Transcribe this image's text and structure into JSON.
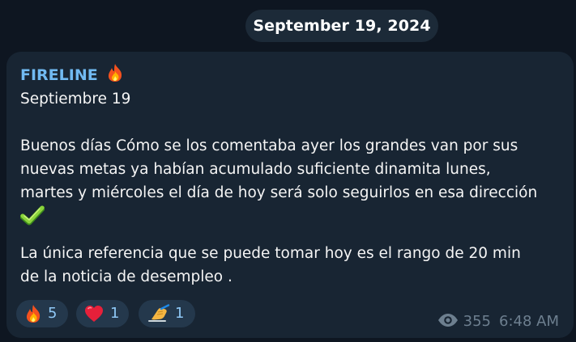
{
  "date_separator": "September 19, 2024",
  "message": {
    "sender": "FIRELINE",
    "sender_emoji": "fire-icon",
    "text": {
      "line1": "Septiembre 19",
      "line2": "Buenos días Cómo se los comentaba ayer los grandes van por sus",
      "line3": "nuevas metas ya habían acumulado suficiente dinamita lunes,",
      "line4": "martes y miércoles el día de hoy será solo seguirlos en esa dirección",
      "check_emoji": "check-mark-icon",
      "line5": "La única referencia que se puede tomar hoy es el rango de 20 min",
      "line6": "de la noticia de desempleo ."
    },
    "reactions": [
      {
        "emoji": "fire-icon",
        "count": "5"
      },
      {
        "emoji": "heart-icon",
        "count": "1"
      },
      {
        "emoji": "writing-hand-icon",
        "count": "1"
      }
    ],
    "views": "355",
    "time": "6:48 AM"
  },
  "colors": {
    "background": "#0e1621",
    "bubble": "#182533",
    "sender": "#71baf2",
    "reaction_bg": "#24384c",
    "reaction_count": "#8fc8f6",
    "meta": "#6d7f8f"
  }
}
